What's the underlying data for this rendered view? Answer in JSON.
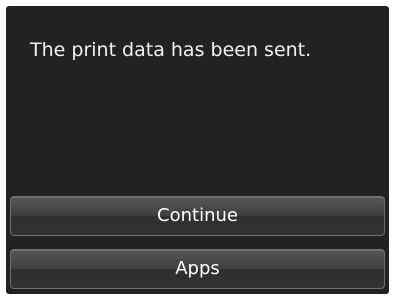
{
  "dialog": {
    "message": "The print data has been sent."
  },
  "buttons": {
    "continue_label": "Continue",
    "apps_label": "Apps"
  },
  "colors": {
    "screen_background": "#222222",
    "button_background": "#404040",
    "text": "#ffffff"
  }
}
